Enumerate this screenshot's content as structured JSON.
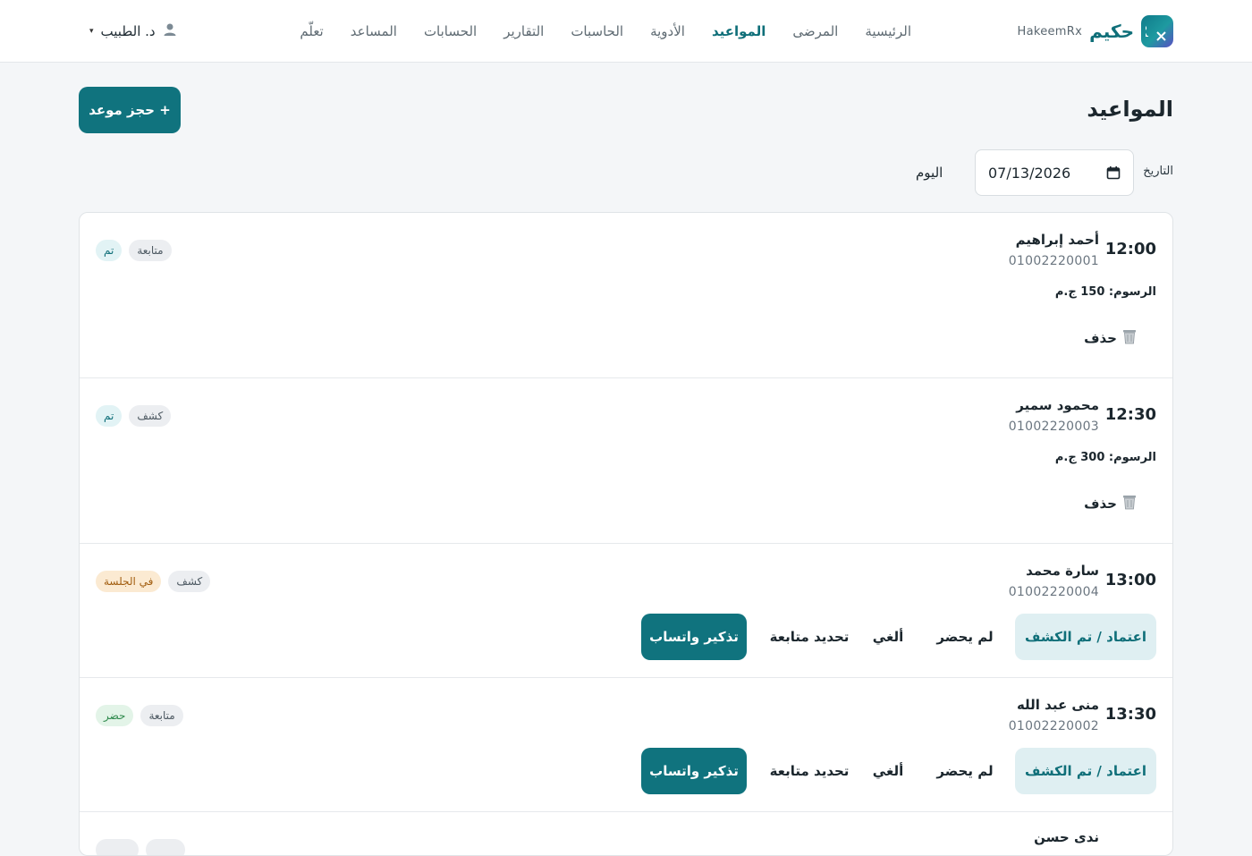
{
  "brand": {
    "name_ar": "حكيم",
    "name_en": "HakeemRx",
    "logo": "rx-logo-icon"
  },
  "nav": {
    "items": [
      {
        "label": "الرئيسية",
        "active": false
      },
      {
        "label": "المرضى",
        "active": false
      },
      {
        "label": "المواعيد",
        "active": true
      },
      {
        "label": "الأدوية",
        "active": false
      },
      {
        "label": "الحاسبات",
        "active": false
      },
      {
        "label": "التقارير",
        "active": false
      },
      {
        "label": "الحسابات",
        "active": false
      },
      {
        "label": "المساعد",
        "active": false
      },
      {
        "label": "تعلّم",
        "active": false
      }
    ]
  },
  "user": {
    "name": "د. الطبيب",
    "icon": "user-icon",
    "caret": "▾"
  },
  "page": {
    "title": "المواعيد",
    "new_button": "+ حجز موعد",
    "date_label": "التاريخ",
    "date_value": "07/13/2026",
    "today_label": "اليوم"
  },
  "appointments": [
    {
      "time": "12:00",
      "name": "أحمد إبراهيم",
      "phone": "01002220001",
      "badges": [
        {
          "label": "متابعة",
          "kind": "type"
        },
        {
          "label": "تم",
          "kind": "done"
        }
      ],
      "fee_label": "الرسوم:",
      "fee_value": "150 ج.م",
      "delete_label": "حذف"
    },
    {
      "time": "12:30",
      "name": "محمود سمير",
      "phone": "01002220003",
      "badges": [
        {
          "label": "كشف",
          "kind": "type"
        },
        {
          "label": "تم",
          "kind": "done"
        }
      ],
      "fee_label": "الرسوم:",
      "fee_value": "300 ج.م",
      "delete_label": "حذف"
    },
    {
      "time": "13:00",
      "name": "سارة محمد",
      "phone": "01002220004",
      "badges": [
        {
          "label": "كشف",
          "kind": "type"
        },
        {
          "label": "في الجلسة",
          "kind": "insession"
        }
      ],
      "actions": {
        "confirm": "اعتماد / تم الكشف",
        "no_show": "لم يحضر",
        "cancel": "ألغي",
        "followup": "تحديد متابعة",
        "whatsapp": "تذكير واتساب"
      }
    },
    {
      "time": "13:30",
      "name": "منى عبد الله",
      "phone": "01002220002",
      "badges": [
        {
          "label": "متابعة",
          "kind": "type"
        },
        {
          "label": "حضر",
          "kind": "present"
        }
      ],
      "actions": {
        "confirm": "اعتماد / تم الكشف",
        "no_show": "لم يحضر",
        "cancel": "ألغي",
        "followup": "تحديد متابعة",
        "whatsapp": "تذكير واتساب"
      }
    }
  ],
  "partial_row": {
    "name": "ندى حسن"
  },
  "colors": {
    "primary": "#10737e",
    "accent_text": "#0f6f79",
    "page_bg": "#f4f6f8"
  }
}
